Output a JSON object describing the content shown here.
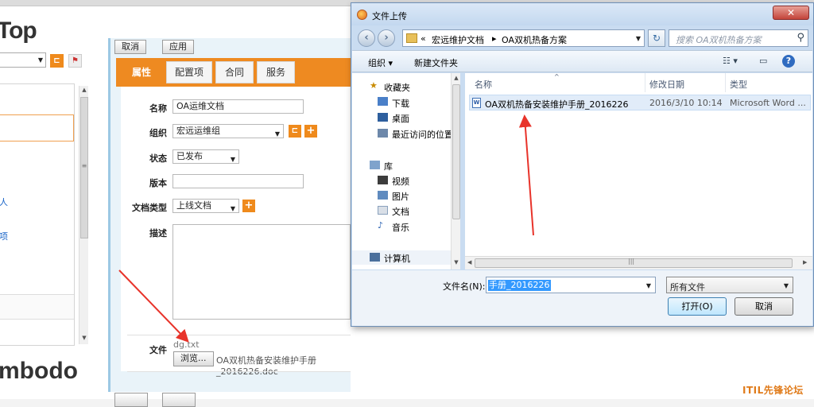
{
  "bg_app": {
    "logo_top": "Top",
    "logo_bottom": "mbodo",
    "left_links": [
      "人",
      "项"
    ],
    "cancel_label": "取消",
    "apply_label": "应用",
    "tabs": [
      "属性",
      "配置项",
      "合同",
      "服务"
    ],
    "form": {
      "name_label": "名称",
      "name_value": "OA运维文档",
      "group_label": "组织",
      "group_value": "宏远运维组",
      "status_label": "状态",
      "status_value": "已发布",
      "version_label": "版本",
      "version_value": "",
      "doctype_label": "文档类型",
      "doctype_value": "上线文档",
      "desc_label": "描述",
      "file_label": "文件",
      "file_current": "dg.txt",
      "browse_label": "浏览...",
      "file_selected": "OA双机热备安装维护手册_2016226.doc"
    }
  },
  "dialog": {
    "title": "文件上传",
    "close_label": "✕",
    "address_parts": [
      "«",
      "宏远维护文档",
      "▸",
      "OA双机热备方案"
    ],
    "search_placeholder": "搜索 OA双机热备方案",
    "toolbar": {
      "organize": "组织 ▾",
      "new_folder": "新建文件夹"
    },
    "nav": {
      "favorites": "收藏夹",
      "downloads": "下载",
      "desktop": "桌面",
      "recent": "最近访问的位置",
      "libraries": "库",
      "videos": "视频",
      "pictures": "图片",
      "documents": "文档",
      "music": "音乐",
      "computer": "计算机"
    },
    "columns": [
      "名称",
      "修改日期",
      "类型"
    ],
    "files": [
      {
        "name": "OA双机热备安装维护手册_2016226",
        "date": "2016/3/10 10:14",
        "type": "Microsoft Word ..."
      }
    ],
    "filename_label": "文件名(N):",
    "filename_value": "手册_2016226",
    "filetype_value": "所有文件",
    "open_label": "打开(O)",
    "cancel_label": "取消"
  },
  "watermark": "ITIL先锋论坛",
  "colors": {
    "accent": "#ee8a21",
    "link": "#1a65c8",
    "annotation": "#e8332a"
  }
}
